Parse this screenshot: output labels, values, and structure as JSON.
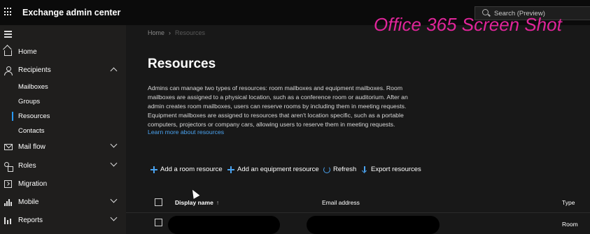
{
  "header": {
    "app_title": "Exchange admin center",
    "search_placeholder": "Search (Preview)"
  },
  "watermark": "Office 365 Screen Shot",
  "sidebar": {
    "items": [
      {
        "label": "Home"
      },
      {
        "label": "Recipients",
        "expanded": true
      },
      {
        "label": "Mailboxes"
      },
      {
        "label": "Groups"
      },
      {
        "label": "Resources",
        "selected": true
      },
      {
        "label": "Contacts"
      },
      {
        "label": "Mail flow"
      },
      {
        "label": "Roles"
      },
      {
        "label": "Migration"
      },
      {
        "label": "Mobile"
      },
      {
        "label": "Reports"
      }
    ]
  },
  "breadcrumb": {
    "home": "Home",
    "current": "Resources"
  },
  "page": {
    "title": "Resources",
    "description": "Admins can manage two types of resources: room mailboxes and equipment mailboxes. Room mailboxes are assigned to a physical location, such as a conference room or auditorium. After an admin creates room mailboxes, users can reserve rooms by including them in meeting requests. Equipment mailboxes are assigned to resources that aren't location specific, such as a portable computers, projectors or company cars, allowing users to reserve them in meeting requests.",
    "learn_more": "Learn more about resources"
  },
  "toolbar": {
    "add_room": "Add a room resource",
    "add_equipment": "Add an equipment resource",
    "refresh": "Refresh",
    "export": "Export resources"
  },
  "table": {
    "columns": {
      "display_name": "Display name",
      "email": "Email address",
      "type": "Type"
    },
    "sort_indicator": "↑",
    "rows": [
      {
        "type": "Room"
      }
    ]
  },
  "colors": {
    "accent": "#4aa3f0",
    "watermark": "#e0259a",
    "background": "#181818"
  }
}
